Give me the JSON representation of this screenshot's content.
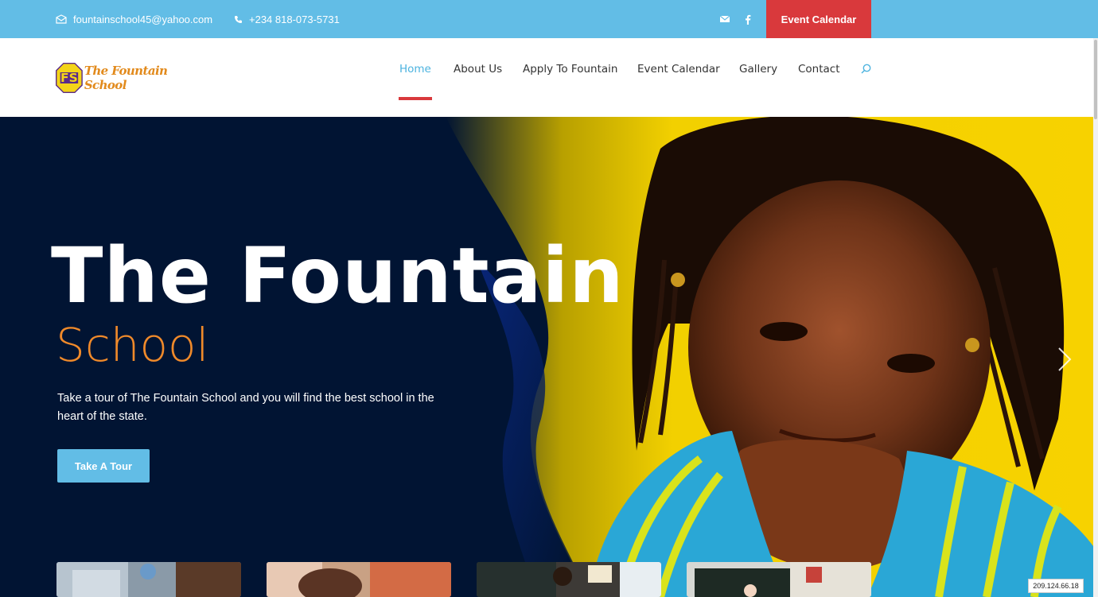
{
  "topbar": {
    "email": "fountainschool45@yahoo.com",
    "phone": "+234 818-073-5731",
    "event_button": "Event Calendar",
    "bg_color": "#62bde6",
    "accent_color": "#d9393c"
  },
  "header": {
    "logo_text": "The Fountain School",
    "logo_badge": "FS",
    "nav": [
      {
        "label": "Home",
        "active": true
      },
      {
        "label": "About Us"
      },
      {
        "label": "Apply To Fountain"
      },
      {
        "label": "Event Calendar"
      },
      {
        "label": "Gallery"
      },
      {
        "label": "Contact"
      }
    ]
  },
  "hero": {
    "title": "The Fountain",
    "subtitle": "School",
    "description": "Take a tour of The Fountain School and you will find the best school in the heart of the state.",
    "button": "Take A Tour"
  },
  "ip_badge": "209.124.66.18"
}
